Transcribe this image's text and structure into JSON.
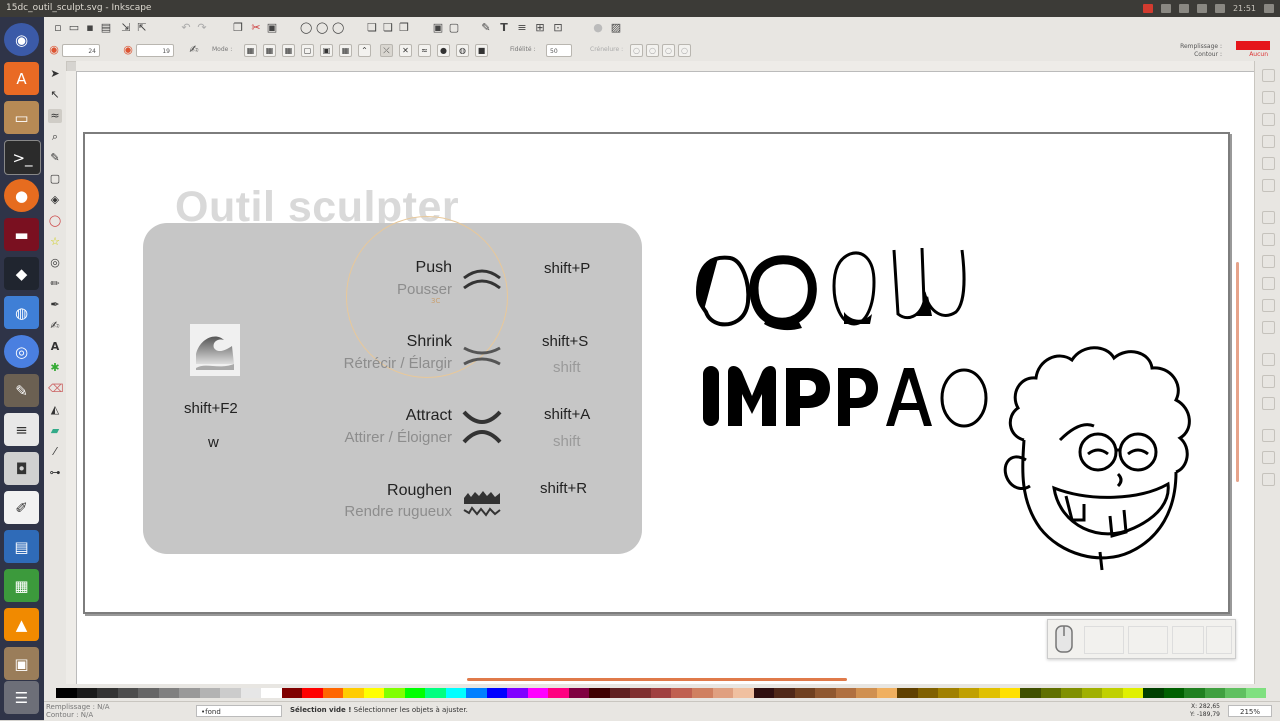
{
  "window": {
    "title": "15dc_outil_sculpt.svg - Inkscape",
    "clock": "21:51"
  },
  "launcher": {
    "icons": [
      "dash-icon",
      "software-center-icon",
      "files-icon",
      "terminal-icon",
      "firefox-icon",
      "screen-recorder-icon",
      "inkscape-icon",
      "blender-icon",
      "chromium-icon",
      "gimp-icon",
      "text-editor-icon",
      "screenshot-icon",
      "document-icon",
      "writer-icon",
      "calc-icon",
      "vlc-icon",
      "archive-icon",
      "trash-icon"
    ]
  },
  "toolbar": {
    "width_value": "24",
    "strength_value": "19",
    "mode_label": "Mode :",
    "fidelity_label": "Fidélité :",
    "fidelity_value": "50",
    "pressure_label": "Crénelure :",
    "fill_label": "Remplissage :",
    "stroke_label": "Contour :",
    "stroke_value": "Aucun",
    "fill_color": "#e5161b"
  },
  "slide": {
    "title": "Outil sculpter",
    "tool_shortcut": "shift+F2",
    "tool_key": "w",
    "modes": [
      {
        "en": "Push",
        "fr": "Pousser",
        "shortcut": "shift+P",
        "shortcut2": ""
      },
      {
        "en": "Shrink",
        "fr": "Rétrécir / Élargir",
        "shortcut": "shift+S",
        "shortcut2": "shift"
      },
      {
        "en": "Attract",
        "fr": "Attirer / Éloigner",
        "shortcut": "shift+A",
        "shortcut2": "shift"
      },
      {
        "en": "Roughen",
        "fr": "Rendre rugueux",
        "shortcut": "shift+R",
        "shortcut2": ""
      }
    ],
    "cursor_hint": "3C"
  },
  "artwork": {
    "letters": "IMPPAO"
  },
  "status": {
    "fill_text": "Remplissage :",
    "stroke_text": "Contour :",
    "fill_value": "N/A",
    "stroke_value": "N/A",
    "layer": "•fond",
    "message_bold": "Sélection vide !",
    "message": " Sélectionner les objets à ajuster.",
    "coord_x": "282,65",
    "coord_y": "-189,79",
    "zoom": "215%"
  },
  "palette_colors": [
    "#000000",
    "#1a1a1a",
    "#333333",
    "#4d4d4d",
    "#666666",
    "#808080",
    "#999999",
    "#b3b3b3",
    "#cccccc",
    "#e6e6e6",
    "#ffffff",
    "#800000",
    "#ff0000",
    "#ff6600",
    "#ffcc00",
    "#ffff00",
    "#80ff00",
    "#00ff00",
    "#00ff80",
    "#00ffff",
    "#0080ff",
    "#0000ff",
    "#8000ff",
    "#ff00ff",
    "#ff0080",
    "#800040",
    "#400000",
    "#602020",
    "#803030",
    "#a04040",
    "#c06050",
    "#d08060",
    "#e0a080",
    "#f0c0a0",
    "#301010",
    "#502818",
    "#704020",
    "#905830",
    "#b07040",
    "#d09050",
    "#f0b060",
    "#604000",
    "#806000",
    "#a08000",
    "#c0a000",
    "#e0c000",
    "#ffe000",
    "#405000",
    "#607000",
    "#809000",
    "#a0b000",
    "#c0d000",
    "#e0f000",
    "#004000",
    "#006000",
    "#208020",
    "#40a040",
    "#60c060",
    "#80e080"
  ]
}
